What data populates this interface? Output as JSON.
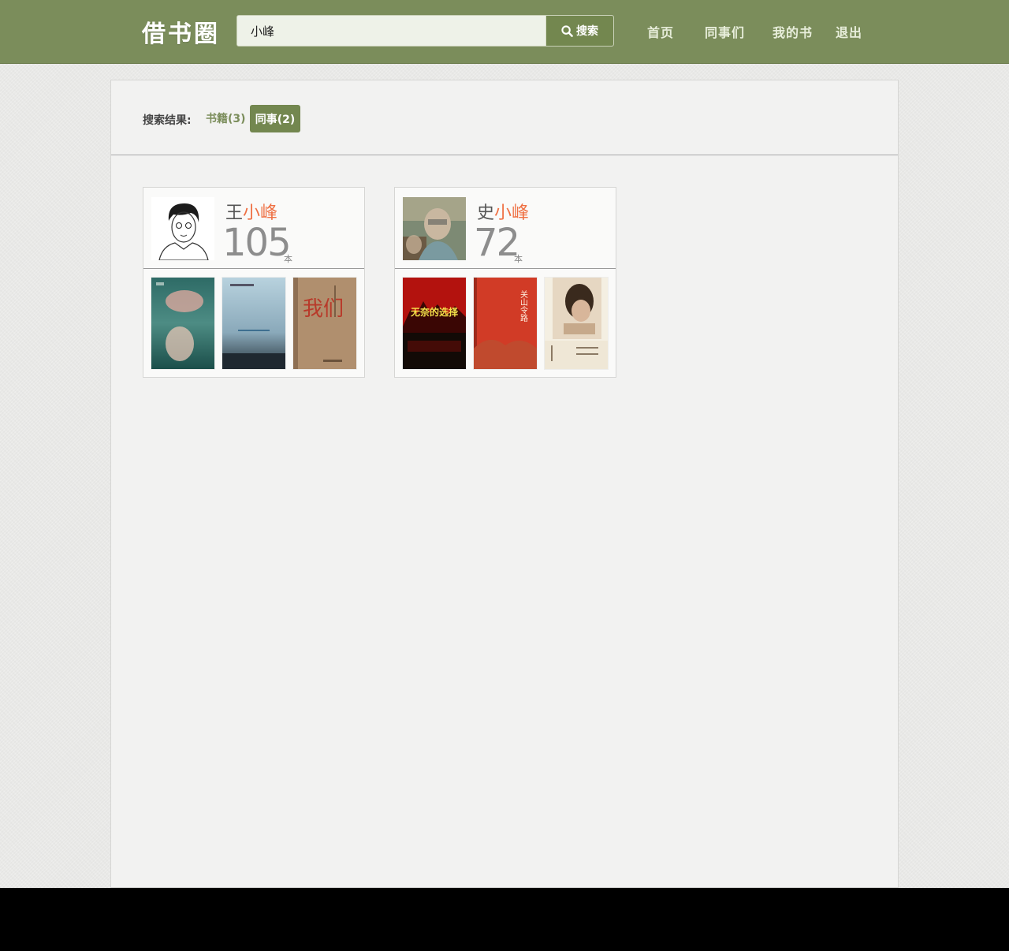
{
  "header": {
    "logo": "借书圈",
    "search": {
      "value": "小峰",
      "button_label": "搜索"
    },
    "nav": [
      {
        "label": "首页"
      },
      {
        "label": "同事们"
      },
      {
        "label": "我的书"
      },
      {
        "label": "退出"
      }
    ]
  },
  "results": {
    "label": "搜索结果:",
    "filters": [
      {
        "label": "书籍(3)",
        "active": false
      },
      {
        "label": "同事(2)",
        "active": true
      }
    ]
  },
  "colleagues": [
    {
      "surname": "王",
      "match": "小峰",
      "count": "105",
      "unit": "本",
      "books": [
        "book-cover-1",
        "book-cover-2",
        "book-cover-3"
      ]
    },
    {
      "surname": "史",
      "match": "小峰",
      "count": "72",
      "unit": "本",
      "books": [
        "book-cover-1",
        "book-cover-2",
        "book-cover-3"
      ]
    }
  ],
  "book_cover_text": {
    "b3": "我们",
    "b4": "无奈的选择",
    "b5": "关山令路"
  },
  "colors": {
    "header_bg": "#7b8d5b",
    "accent_green": "#73874f",
    "highlight": "#ef7043"
  }
}
